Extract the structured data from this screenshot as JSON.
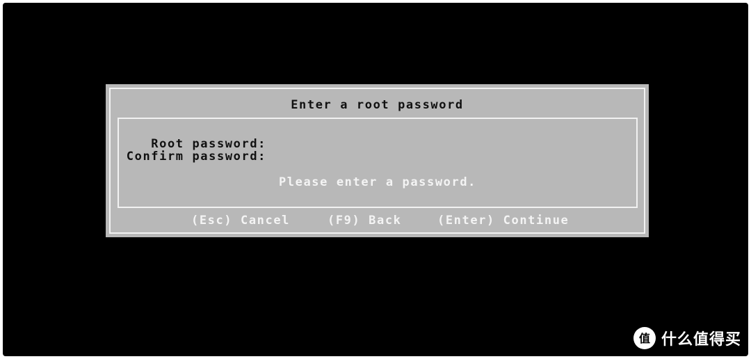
{
  "dialog": {
    "title": "Enter a root password",
    "fields": {
      "root_label": "Root password:",
      "confirm_label": "Confirm password:",
      "root_value": "",
      "confirm_value": ""
    },
    "message": "Please enter a password.",
    "actions": {
      "cancel": "(Esc) Cancel",
      "back": "(F9) Back",
      "continue": "(Enter) Continue"
    }
  },
  "watermark": {
    "logo_glyph": "值",
    "text": "什么值得买"
  },
  "colors": {
    "screen_background": "#000000",
    "dialog_background": "#b8b8b8",
    "dialog_border": "#f2f2f2",
    "dark_text": "#111111",
    "light_text": "#f4f4f4"
  }
}
